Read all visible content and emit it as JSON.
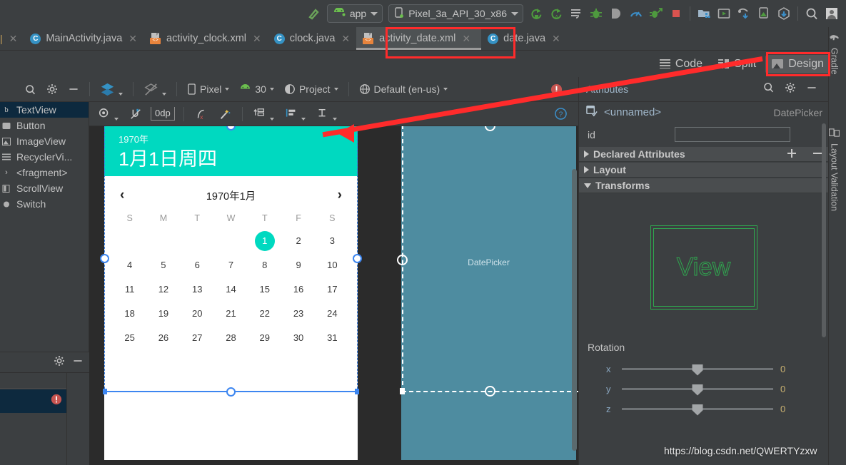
{
  "toolbar": {
    "run_config": {
      "label": "app",
      "icon": "android-icon"
    },
    "device": {
      "label": "Pixel_3a_API_30_x86",
      "icon": "device-icon"
    },
    "icons": [
      {
        "name": "hammer-build-icon",
        "glyph": "hammer"
      },
      {
        "name": "run-icon",
        "glyph": "run"
      },
      {
        "name": "apply-changes-icon",
        "glyph": "apply"
      },
      {
        "name": "apply-code-changes-icon",
        "glyph": "code-changes"
      },
      {
        "name": "debug-icon",
        "glyph": "bug"
      },
      {
        "name": "attach-debugger-icon",
        "glyph": "attach"
      },
      {
        "name": "profiler-icon",
        "glyph": "profile"
      },
      {
        "name": "run-coverage-icon",
        "glyph": "coverage"
      },
      {
        "name": "stop-icon",
        "glyph": "stop"
      },
      {
        "name": "sdk-manager-icon",
        "glyph": "sdk"
      },
      {
        "name": "avd-manager-icon",
        "glyph": "avd"
      },
      {
        "name": "device-file-explorer-icon",
        "glyph": "explorer"
      },
      {
        "name": "layout-inspector-icon",
        "glyph": "inspector"
      },
      {
        "name": "gradle-sync-icon",
        "glyph": "sync"
      },
      {
        "name": "search-everywhere-icon",
        "glyph": "search"
      },
      {
        "name": "account-icon",
        "glyph": "avatar"
      }
    ]
  },
  "tabs": [
    {
      "label": "MainActivity.java",
      "icon": "java-class-icon",
      "selected": false,
      "closable": true
    },
    {
      "label": "activity_clock.xml",
      "icon": "xml-layout-icon",
      "selected": false,
      "closable": true
    },
    {
      "label": "clock.java",
      "icon": "java-class-icon",
      "selected": false,
      "closable": true
    },
    {
      "label": "activity_date.xml",
      "icon": "xml-layout-icon",
      "selected": true,
      "closable": true
    },
    {
      "label": "date.java",
      "icon": "java-class-icon",
      "selected": false,
      "closable": true
    }
  ],
  "editor_modes": [
    {
      "label": "Code",
      "icon": "code-mode-icon",
      "selected": false
    },
    {
      "label": "Split",
      "icon": "split-mode-icon",
      "selected": false
    },
    {
      "label": "Design",
      "icon": "design-mode-icon",
      "selected": true
    }
  ],
  "design_toolbar": {
    "search_icon": "search-icon",
    "settings_icon": "gear-icon",
    "minimize_icon": "minimize-icon",
    "design_surface_icon": "layers-icon",
    "blueprint_toggle_icon": "blueprint-icon",
    "device": "Pixel",
    "api_level": "30",
    "theme": "Project",
    "locale": "Default (en-us)",
    "error_icon": "error-icon"
  },
  "constraint_toolbar": {
    "view_options_icon": "view-options-icon",
    "autoconnect_icon": "autoconnect-off-icon",
    "margin_value": "0dp",
    "clear_constraints_icon": "clear-constraints-icon",
    "infer_constraints_icon": "magic-wand-icon",
    "pack_icon": "pack-icon",
    "align_icon": "align-icon",
    "guidelines_icon": "guidelines-icon",
    "help_icon": "help-icon"
  },
  "palette": {
    "items": [
      {
        "label": "TextView",
        "icon": "textview-icon",
        "selected": true
      },
      {
        "label": "Button",
        "icon": "button-icon",
        "selected": false
      },
      {
        "label": "ImageView",
        "icon": "imageview-icon",
        "selected": false
      },
      {
        "label": "RecyclerVi...",
        "icon": "recyclerview-icon",
        "selected": false
      },
      {
        "label": "<fragment>",
        "icon": "fragment-icon",
        "selected": false
      },
      {
        "label": "ScrollView",
        "icon": "scrollview-icon",
        "selected": false
      },
      {
        "label": "Switch",
        "icon": "switch-icon",
        "selected": false
      }
    ]
  },
  "component_tree": {
    "gear_icon": "gear-icon",
    "minimize_icon": "minimize-icon",
    "error_badge_icon": "error-icon"
  },
  "preview": {
    "datepicker": {
      "header_year": "1970年",
      "header_date": "1月1日周四",
      "header_color": "#00d9c0",
      "prev_icon": "chevron-left-icon",
      "next_icon": "chevron-right-icon",
      "month_title": "1970年1月",
      "weekdays": [
        "S",
        "M",
        "T",
        "W",
        "T",
        "F",
        "S"
      ],
      "leading_blanks": 4,
      "days": [
        1,
        2,
        3,
        4,
        5,
        6,
        7,
        8,
        9,
        10,
        11,
        12,
        13,
        14,
        15,
        16,
        17,
        18,
        19,
        20,
        21,
        22,
        23,
        24,
        25,
        26,
        27,
        28,
        29,
        30,
        31
      ],
      "selected_day": 1
    },
    "blueprint_label": "DatePicker"
  },
  "attributes": {
    "component_icon": "datepicker-component-icon",
    "component_name": "<unnamed>",
    "component_type": "DatePicker",
    "search_icon": "search-icon",
    "settings_icon": "gear-icon",
    "minimize_icon": "minimize-icon",
    "panel_title": "Attributes",
    "id_label": "id",
    "id_value": "",
    "sections": [
      {
        "label": "Declared Attributes",
        "expanded": false,
        "add_icon": "plus-icon",
        "remove_icon": "minus-icon"
      },
      {
        "label": "Layout",
        "expanded": false
      },
      {
        "label": "Transforms",
        "expanded": true
      }
    ],
    "view_preview_text": "View",
    "rotation_label": "Rotation",
    "rotation_axes": [
      {
        "axis": "x",
        "value": "0",
        "position": 50
      },
      {
        "axis": "y",
        "value": "0",
        "position": 50
      },
      {
        "axis": "z",
        "value": "0",
        "position": 50
      }
    ]
  },
  "right_tabs": [
    {
      "label": "Gradle",
      "icon": "gradle-elephant-icon"
    },
    {
      "label": "Layout Validation",
      "icon": "layout-validation-icon"
    }
  ],
  "watermark": "https://blog.csdn.net/QWERTYzxw",
  "annotations": {
    "highlight_color": "#ff2b2b"
  }
}
